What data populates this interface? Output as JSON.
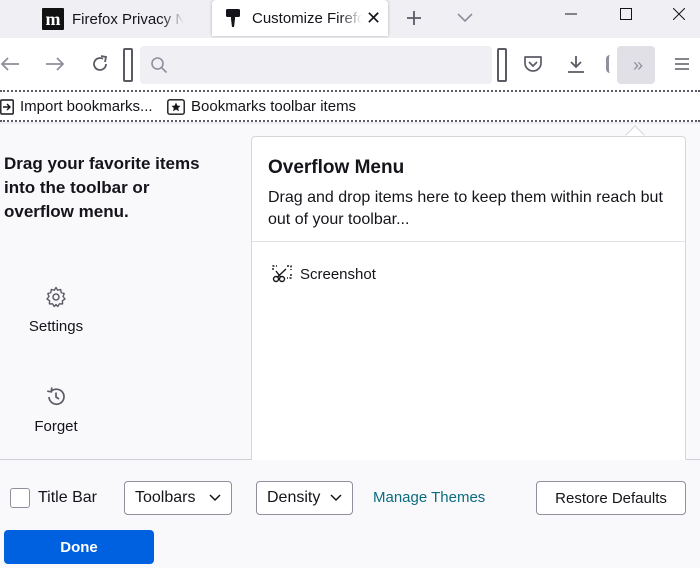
{
  "tabs": [
    {
      "title": "Firefox Privacy Notice",
      "favicon": "m-logo-icon",
      "active": false
    },
    {
      "title": "Customize Firefox",
      "favicon": "customize-brush-icon",
      "active": true,
      "close": "✕"
    }
  ],
  "tabstrip": {
    "new_tab": "+",
    "list_all": "⌄"
  },
  "window_controls": {
    "minimize": "—",
    "maximize": "☐",
    "close": "✕"
  },
  "navbar": {
    "icons": [
      "back-arrow-icon",
      "forward-arrow-icon",
      "reload-icon",
      "search-icon",
      "pocket-icon",
      "download-icon",
      "overflow-chevron-icon",
      "hamburger-menu-icon"
    ],
    "overflow_glyph": "»"
  },
  "bookmarks": {
    "import_label": "Import bookmarks...",
    "items_label": "Bookmarks toolbar items"
  },
  "customize": {
    "instructions": "Drag your favorite items into the toolbar or overflow menu.",
    "palette": [
      {
        "label": "Settings",
        "icon": "gear-icon"
      },
      {
        "label": "Forget",
        "icon": "history-clock-icon"
      }
    ]
  },
  "overflow_panel": {
    "title": "Overflow Menu",
    "description": "Drag and drop items here to keep them within reach but out of your toolbar...",
    "items": [
      {
        "label": "Screenshot",
        "icon": "screenshot-icon"
      }
    ]
  },
  "footer": {
    "title_bar_label": "Title Bar",
    "title_bar_checked": false,
    "toolbars_label": "Toolbars",
    "density_label": "Density",
    "manage_themes_label": "Manage Themes",
    "restore_defaults_label": "Restore Defaults",
    "done_label": "Done"
  },
  "colors": {
    "accent": "#0061e0",
    "link": "#0c6b7f"
  }
}
